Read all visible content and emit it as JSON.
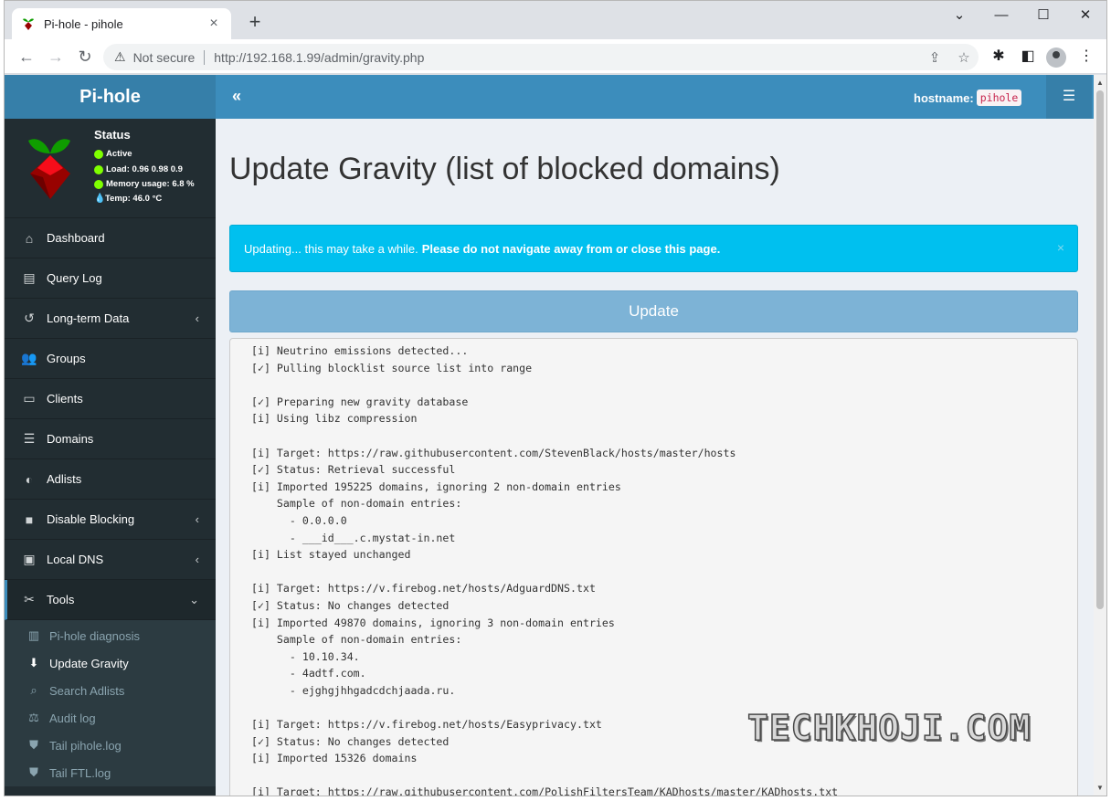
{
  "browser": {
    "tab_title": "Pi-hole - pihole",
    "tab_close": "×",
    "new_tab": "+",
    "security_label": "Not secure",
    "url": "http://192.168.1.99/admin/gravity.php",
    "window_controls": [
      "⌄",
      "—",
      "☐",
      "✕"
    ]
  },
  "sidebar": {
    "logo": "Pi-hole",
    "status": {
      "heading": "Status",
      "active": "Active",
      "load": "Load:  0.96  0.98  0.9",
      "memory": "Memory usage:  6.8 %",
      "temp": "Temp: 46.0 °C"
    },
    "menu": [
      {
        "label": "Dashboard",
        "icon": "home-icon"
      },
      {
        "label": "Query Log",
        "icon": "file-icon"
      },
      {
        "label": "Long-term Data",
        "icon": "history-icon"
      },
      {
        "label": "Groups",
        "icon": "users-icon"
      },
      {
        "label": "Clients",
        "icon": "laptop-icon"
      },
      {
        "label": "Domains",
        "icon": "list-icon"
      },
      {
        "label": "Adlists",
        "icon": "shield-icon"
      },
      {
        "label": "Disable Blocking",
        "icon": "stop-icon"
      },
      {
        "label": "Local DNS",
        "icon": "address-book-icon"
      },
      {
        "label": "Tools",
        "icon": "tools-icon"
      }
    ],
    "tools_submenu": [
      {
        "label": "Pi-hole diagnosis",
        "icon": "file-medical-icon"
      },
      {
        "label": "Update Gravity",
        "icon": "arrow-circle-down-icon"
      },
      {
        "label": "Search Adlists",
        "icon": "search-icon"
      },
      {
        "label": "Audit log",
        "icon": "balance-scale-icon"
      },
      {
        "label": "Tail pihole.log",
        "icon": "list-ul-icon"
      },
      {
        "label": "Tail FTL.log",
        "icon": "list-ul-icon"
      }
    ]
  },
  "navbar": {
    "toggle": "«",
    "hostname_label": "hostname:",
    "hostname_value": "pihole"
  },
  "main": {
    "title": "Update Gravity (list of blocked domains)",
    "alert_text": "Updating... this may take a while.",
    "alert_bold": "Please do not navigate away from or close this page.",
    "alert_close": "×",
    "update_button": "Update",
    "output_lines": [
      "[i] Neutrino emissions detected...",
      "[✓] Pulling blocklist source list into range",
      "",
      "[✓] Preparing new gravity database",
      "[i] Using libz compression",
      "",
      "[i] Target: https://raw.githubusercontent.com/StevenBlack/hosts/master/hosts",
      "[✓] Status: Retrieval successful",
      "[i] Imported 195225 domains, ignoring 2 non-domain entries",
      "    Sample of non-domain entries:",
      "      - 0.0.0.0",
      "      - ___id___.c.mystat-in.net",
      "[i] List stayed unchanged",
      "",
      "[i] Target: https://v.firebog.net/hosts/AdguardDNS.txt",
      "[✓] Status: No changes detected",
      "[i] Imported 49870 domains, ignoring 3 non-domain entries",
      "    Sample of non-domain entries:",
      "      - 10.10.34.",
      "      - 4adtf.com.",
      "      - ejghgjhhgadcdchjaada.ru.",
      "",
      "[i] Target: https://v.firebog.net/hosts/Easyprivacy.txt",
      "[✓] Status: No changes detected",
      "[i] Imported 15326 domains",
      "",
      "[i] Target: https://raw.githubusercontent.com/PolishFiltersTeam/KADhosts/master/KADhosts.txt"
    ]
  },
  "watermark": "TECHKHOJI.COM",
  "colors": {
    "sidebar_bg": "#222d32",
    "navbar_bg": "#3c8dbc",
    "logo_bg": "#367fa9",
    "alert_bg": "#00c0ef",
    "button_bg": "#7db3d6",
    "status_green": "#7fff00"
  }
}
